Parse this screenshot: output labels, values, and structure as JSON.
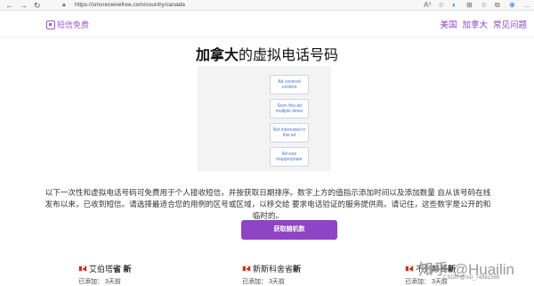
{
  "browser": {
    "back": "←",
    "forward": "→",
    "reload": "↻",
    "url": "https://smsreceivefree.com/country/canada",
    "toolbar_icons": [
      "A⁰",
      "☆",
      "◐",
      "⊞",
      "☆",
      "⧉",
      "⊕",
      "…"
    ]
  },
  "header": {
    "logo_text": "短信免费",
    "nav": [
      "美国",
      "加拿大",
      "常见问题"
    ]
  },
  "title": {
    "bold": "加拿大",
    "rest": "的虚拟电话号码"
  },
  "ad": {
    "options": [
      "Ad covered content",
      "Seen this ad multiple times",
      "Not interested in this ad",
      "Ad was inappropriate"
    ]
  },
  "description": "以下一次性和虚拟电话号码可免费用于个人接收短信，并按获取日期排序。数字上方的值指示添加时间以及添加数量 自从该号码在线发布以来，已收到短信。请选择最适合您的用例的区号或区域，以移交给 要求电话验证的服务提供商。请记住，这些数字是公开的和临时的。",
  "random_button": "获取随机数",
  "cards": [
    {
      "region": "艾伯塔",
      "bold": "省 新",
      "meta": "已添加：   3天前"
    },
    {
      "region": "新斯科舍省",
      "bold": "新",
      "meta": "已添加：   3天前"
    },
    {
      "region": "不列颠哥",
      "bold": "新",
      "meta": "已添加：   3天前"
    }
  ],
  "watermark": "知乎 @Huailin",
  "csdn": "CSDN @m0_74861569",
  "colors": {
    "accent": "#8e44c4",
    "ad_text": "#4a79c9"
  }
}
